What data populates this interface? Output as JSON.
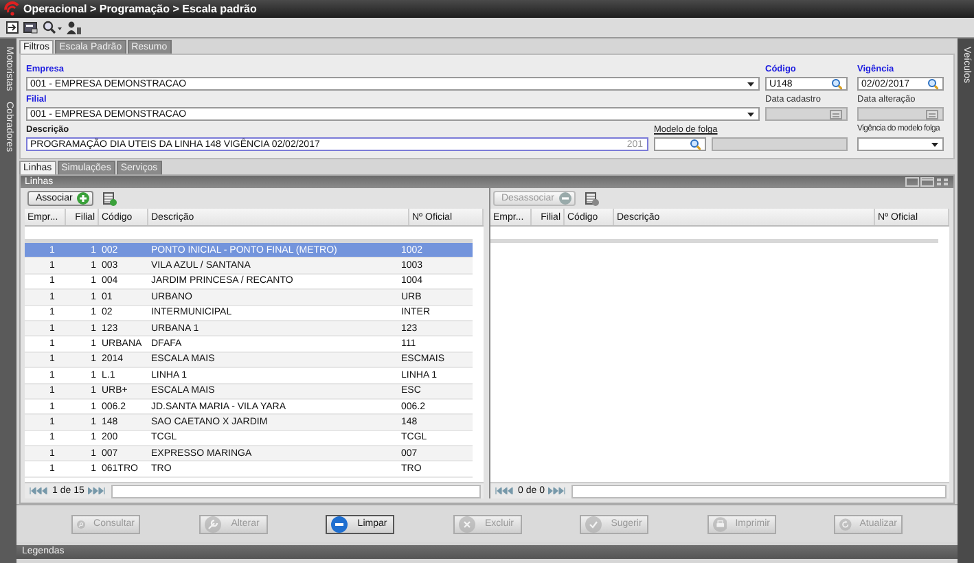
{
  "window": {
    "title": "Operacional > Programação > Escala padrão"
  },
  "side_tabs_left": [
    {
      "label": "Motoristas"
    },
    {
      "label": "Cobradores"
    }
  ],
  "side_tabs_right": [
    {
      "label": "Veículos"
    }
  ],
  "tabs": [
    {
      "label": "Filtros",
      "selected": true
    },
    {
      "label": "Escala Padrão",
      "selected": false
    },
    {
      "label": "Resumo",
      "selected": false
    }
  ],
  "form": {
    "rows": [
      [
        {
          "label": "Empresa",
          "required": true,
          "kind": "select",
          "value": "001 - EMPRESA DEMONSTRACAO",
          "disabled": false
        },
        {
          "label": "Código",
          "required": true,
          "kind": "lookup",
          "value": "U148",
          "disabled": false
        },
        {
          "label": "Vigência",
          "required": true,
          "kind": "lookup",
          "value": "02/02/2017",
          "disabled": false
        }
      ],
      [
        {
          "label": "Filial",
          "required": true,
          "kind": "select",
          "value": "001 - EMPRESA DEMONSTRACAO",
          "disabled": false
        },
        {
          "label": "Data cadastro",
          "required": false,
          "kind": "date",
          "disabled": true
        },
        {
          "label": "Data alteração",
          "required": false,
          "kind": "date",
          "disabled": true
        }
      ],
      [
        {
          "label": "Descrição",
          "required": false,
          "kind": "text",
          "value": "PROGRAMAÇÃO DIA UTEIS DA LINHA 148 VIGÊNCIA 02/02/2017",
          "counter": "201",
          "disabled": false
        },
        {
          "label": "Modelo de folga",
          "required": false,
          "link": true,
          "kind": "lookup",
          "disabled": false
        },
        {
          "kind": "display",
          "disabled": true
        },
        {
          "label": "Vigência do modelo folga",
          "required": false,
          "kind": "select",
          "disabled": false
        }
      ]
    ]
  },
  "sub_tabs": [
    {
      "label": "Linhas",
      "selected": true
    },
    {
      "label": "Simulações",
      "selected": false
    },
    {
      "label": "Serviços",
      "selected": false
    }
  ],
  "panel": {
    "title": "Linhas",
    "left": {
      "button": {
        "label": "Associar",
        "disabled": false
      },
      "columns": [
        "Empr...",
        "Filial",
        "Código",
        "Descrição",
        "Nº Oficial"
      ],
      "rows": [
        {
          "cells": [
            "1",
            "1",
            "002",
            "PONTO INICIAL - PONTO FINAL (METRO)",
            "1002"
          ],
          "selected": true
        },
        {
          "cells": [
            "1",
            "1",
            "003",
            "VILA AZUL / SANTANA",
            "1003"
          ],
          "selected": false
        },
        {
          "cells": [
            "1",
            "1",
            "004",
            "JARDIM PRINCESA / RECANTO",
            "1004"
          ],
          "selected": false
        },
        {
          "cells": [
            "1",
            "1",
            "01",
            "URBANO",
            "URB"
          ],
          "selected": false
        },
        {
          "cells": [
            "1",
            "1",
            "02",
            "INTERMUNICIPAL",
            "INTER"
          ],
          "selected": false
        },
        {
          "cells": [
            "1",
            "1",
            "123",
            "URBANA 1",
            "123"
          ],
          "selected": false
        },
        {
          "cells": [
            "1",
            "1",
            "URBANA",
            "DFAFA",
            "111"
          ],
          "selected": false
        },
        {
          "cells": [
            "1",
            "1",
            "2014",
            "ESCALA MAIS",
            "ESCMAIS"
          ],
          "selected": false
        },
        {
          "cells": [
            "1",
            "1",
            "L.1",
            "LINHA 1",
            "LINHA 1"
          ],
          "selected": false
        },
        {
          "cells": [
            "1",
            "1",
            "URB+",
            "ESCALA MAIS",
            "ESC"
          ],
          "selected": false
        },
        {
          "cells": [
            "1",
            "1",
            "006.2",
            "JD.SANTA MARIA - VILA YARA",
            "006.2"
          ],
          "selected": false
        },
        {
          "cells": [
            "1",
            "1",
            "148",
            "SAO CAETANO X JARDIM",
            "148"
          ],
          "selected": false
        },
        {
          "cells": [
            "1",
            "1",
            "200",
            "TCGL",
            "TCGL"
          ],
          "selected": false
        },
        {
          "cells": [
            "1",
            "1",
            "007",
            "EXPRESSO MARINGA",
            "007"
          ],
          "selected": false
        },
        {
          "cells": [
            "1",
            "1",
            "061TRO",
            "TRO",
            "TRO"
          ],
          "selected": false
        }
      ],
      "pager": "1 de 15"
    },
    "right": {
      "button": {
        "label": "Desassociar",
        "disabled": true
      },
      "columns": [
        "Empr...",
        "Filial",
        "Código",
        "Descrição",
        "Nº Oficial"
      ],
      "pager": "0 de 0"
    }
  },
  "actions": [
    {
      "label": "Consultar",
      "disabled": true
    },
    {
      "label": "Alterar",
      "disabled": true
    },
    {
      "label": "Limpar",
      "disabled": false
    },
    {
      "label": "Excluir",
      "disabled": true
    },
    {
      "label": "Sugerir",
      "disabled": true
    },
    {
      "label": "Imprimir",
      "disabled": true
    },
    {
      "label": "Atualizar",
      "disabled": true
    }
  ],
  "legend_bar": {
    "label": "Legendas"
  }
}
